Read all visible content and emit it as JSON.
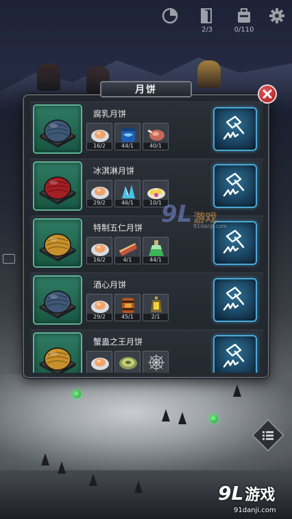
{
  "hud": {
    "timer_icon": "circular-timer-icon",
    "door_icon": "door-icon",
    "door_count": "2/3",
    "bag_icon": "backpack-icon",
    "bag_count": "0/110",
    "settings_icon": "gear-icon"
  },
  "dialog": {
    "title": "月饼",
    "close_icon": "close-icon"
  },
  "recipes": [
    {
      "name": "腐乳月饼",
      "cake_color": "#3f5777",
      "materials": [
        {
          "icon": "flour-plate-icon",
          "count": "16/2"
        },
        {
          "icon": "blue-jar-icon",
          "count": "44/1"
        },
        {
          "icon": "meat-icon",
          "count": "40/1"
        }
      ]
    },
    {
      "name": "冰淇淋月饼",
      "cake_color": "#a31f24",
      "materials": [
        {
          "icon": "flour-plate-icon",
          "count": "29/2"
        },
        {
          "icon": "ice-crystal-icon",
          "count": "46/1"
        },
        {
          "icon": "egg-plate-icon",
          "count": "10/1"
        }
      ]
    },
    {
      "name": "特制五仁月饼",
      "cake_color": "#c8902a",
      "materials": [
        {
          "icon": "flour-plate-icon",
          "count": "16/2"
        },
        {
          "icon": "bread-slice-icon",
          "count": "4/1"
        },
        {
          "icon": "green-potion-icon",
          "count": "44/1"
        }
      ]
    },
    {
      "name": "酒心月饼",
      "cake_color": "#3f5777",
      "materials": [
        {
          "icon": "flour-plate-icon",
          "count": "29/2"
        },
        {
          "icon": "wine-barrel-icon",
          "count": "45/1"
        },
        {
          "icon": "lantern-icon",
          "count": "2/1"
        }
      ]
    },
    {
      "name": "蟹蛊之王月饼",
      "cake_color": "#c8902a",
      "materials": [
        {
          "icon": "flour-plate-icon",
          "count": ""
        },
        {
          "icon": "round-disc-icon",
          "count": ""
        },
        {
          "icon": "spider-web-icon",
          "count": ""
        }
      ]
    }
  ],
  "craft_button_icon": "hammer-icon",
  "side_menu_icon": "list-menu-icon",
  "watermark": {
    "logo": "9L",
    "text": "游戏",
    "sub": "91danji.com"
  }
}
